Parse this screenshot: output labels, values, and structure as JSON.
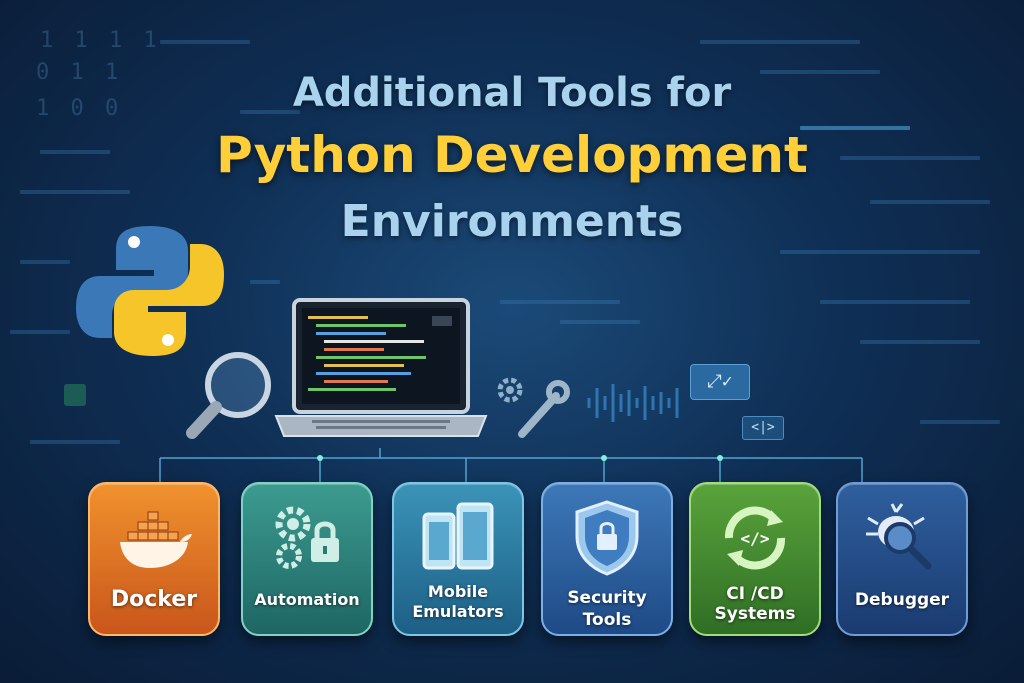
{
  "title": {
    "line1": "Additional Tools for",
    "line2": "Python Development",
    "line3": "Environments"
  },
  "colors": {
    "title_light": "#a9d2ee",
    "title_accent": "#ffcf3a",
    "background": "#0f2f55",
    "python_blue": "#3a78b8",
    "python_yellow": "#f5c52a"
  },
  "icons": {
    "logo": "python-logo",
    "search": "magnifier-icon",
    "computer": "laptop-icon",
    "tools": "gear-wrench-icon",
    "check": "check-badge-icon",
    "code": "code-brackets-icon"
  },
  "badges": {
    "check_symbol": "⤢✓",
    "code_symbol": "<|>"
  },
  "tools": [
    {
      "label": "Docker",
      "icon": "docker-whale-icon",
      "color": "#e07a25"
    },
    {
      "label": "Automation",
      "icon": "gears-lock-icon",
      "color": "#2f857b"
    },
    {
      "label": "Mobile Emulators",
      "label_line1": "Mobile",
      "label_line2": "Emulators",
      "icon": "devices-icon",
      "color": "#2c7aa0"
    },
    {
      "label": "Security Tools",
      "label_line1": "Security",
      "label_line2": "Tools",
      "icon": "shield-lock-icon",
      "color": "#2e62a0"
    },
    {
      "label": "CI /CD Systems",
      "label_line1": "CI /CD",
      "label_line2": "Systems",
      "icon": "code-cycle-icon",
      "color": "#468a30"
    },
    {
      "label": "Debugger",
      "icon": "bug-magnifier-icon",
      "color": "#254d88"
    }
  ],
  "binary_text": {
    "top_left_a": "1 1 1 1",
    "top_left_b": "0 1 1",
    "top_left_c": "1 0 0"
  }
}
